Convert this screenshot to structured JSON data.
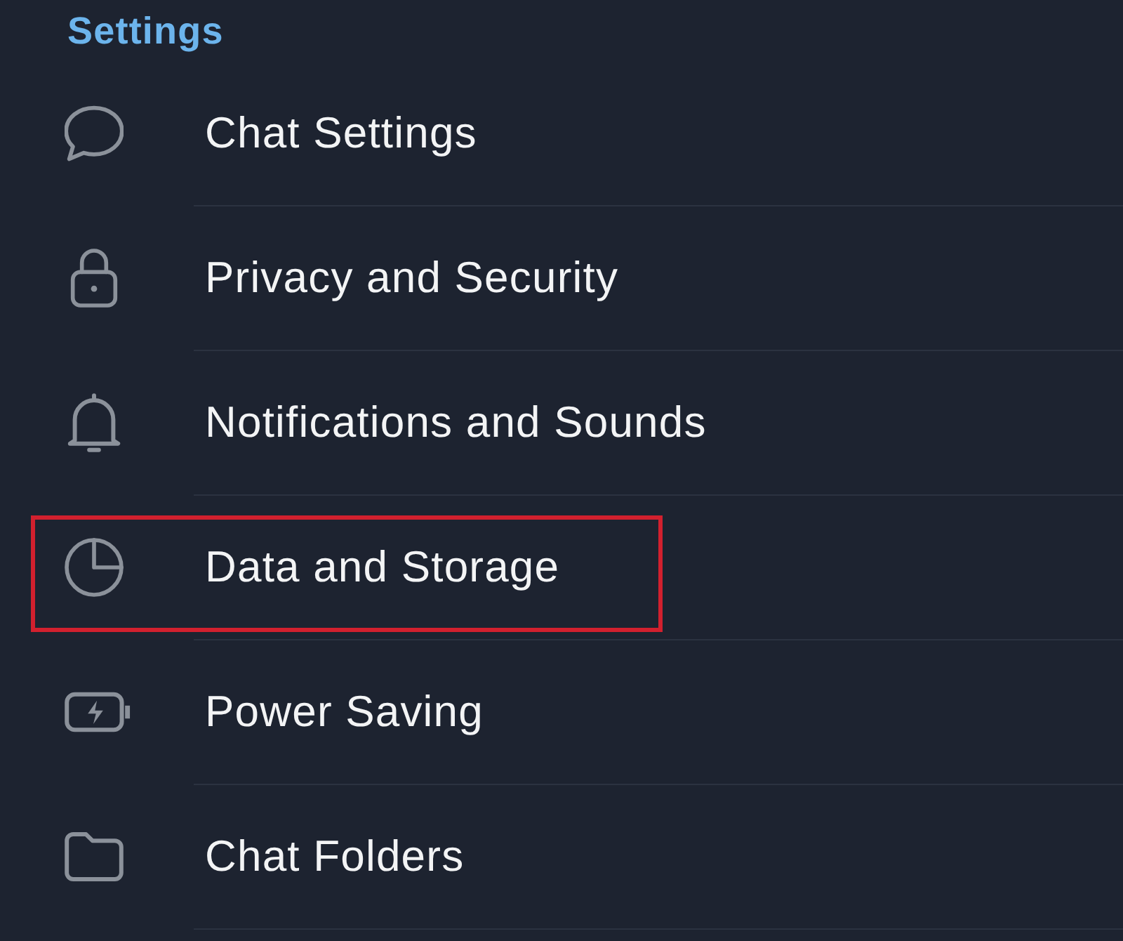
{
  "header": {
    "title": "Settings"
  },
  "items": [
    {
      "label": "Chat Settings",
      "highlighted": false
    },
    {
      "label": "Privacy and Security",
      "highlighted": false
    },
    {
      "label": "Notifications and Sounds",
      "highlighted": false
    },
    {
      "label": "Data and Storage",
      "highlighted": true
    },
    {
      "label": "Power Saving",
      "highlighted": false
    },
    {
      "label": "Chat Folders",
      "highlighted": false
    }
  ]
}
